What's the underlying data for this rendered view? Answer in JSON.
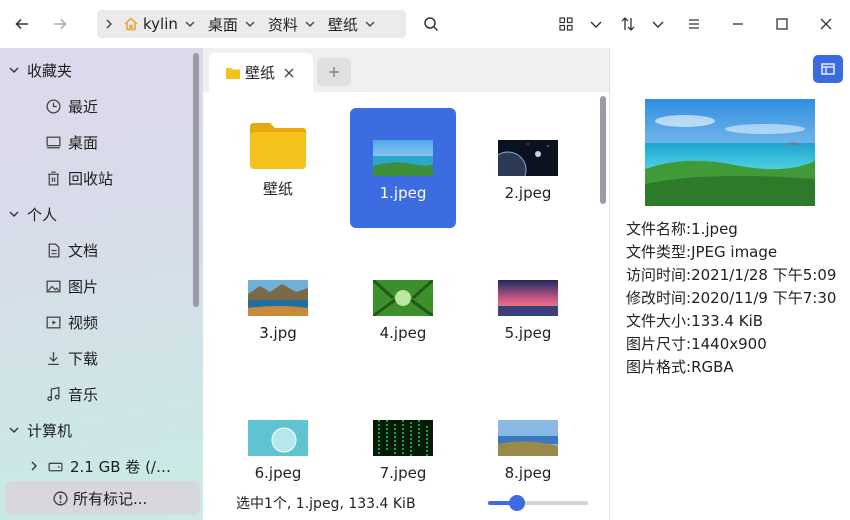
{
  "breadcrumb": [
    {
      "label": "kylin"
    },
    {
      "label": "桌面"
    },
    {
      "label": "资料"
    },
    {
      "label": "壁纸"
    }
  ],
  "sidebar": {
    "sections": [
      {
        "label": "收藏夹"
      },
      {
        "label": "个人"
      },
      {
        "label": "计算机"
      }
    ],
    "items": [
      {
        "label": "最近",
        "icon": "clock-icon"
      },
      {
        "label": "桌面",
        "icon": "desktop-icon"
      },
      {
        "label": "回收站",
        "icon": "trash-icon"
      },
      {
        "label": "文档",
        "icon": "document-icon"
      },
      {
        "label": "图片",
        "icon": "image-icon"
      },
      {
        "label": "视频",
        "icon": "video-icon"
      },
      {
        "label": "下载",
        "icon": "download-icon"
      },
      {
        "label": "音乐",
        "icon": "music-icon"
      },
      {
        "label": "2.1 GB 卷 (/…",
        "icon": "drive-icon"
      },
      {
        "label": "所有标记...",
        "icon": "tag-icon"
      }
    ]
  },
  "tabs": [
    {
      "label": "壁纸"
    }
  ],
  "files": [
    {
      "name": "壁纸",
      "type": "folder"
    },
    {
      "name": "1.jpeg",
      "type": "image",
      "selected": true
    },
    {
      "name": "2.jpeg",
      "type": "image"
    },
    {
      "name": "3.jpg",
      "type": "image"
    },
    {
      "name": "4.jpeg",
      "type": "image"
    },
    {
      "name": "5.jpeg",
      "type": "image"
    },
    {
      "name": "6.jpeg",
      "type": "image"
    },
    {
      "name": "7.jpeg",
      "type": "image"
    },
    {
      "name": "8.jpeg",
      "type": "image"
    }
  ],
  "status": {
    "text": "选中1个, 1.jpeg, 133.4 KiB",
    "zoom_fraction": 0.29
  },
  "details": [
    {
      "key": "文件名称:",
      "value": "1.jpeg"
    },
    {
      "key": "文件类型:",
      "value": "JPEG image"
    },
    {
      "key": "访问时间:",
      "value": "2021/1/28 下午5:09"
    },
    {
      "key": "修改时间:",
      "value": "2020/11/9 下午7:30"
    },
    {
      "key": "文件大小:",
      "value": "133.4 KiB"
    },
    {
      "key": "图片尺寸:",
      "value": "1440x900"
    },
    {
      "key": "图片格式:",
      "value": "RGBA"
    }
  ],
  "colors": {
    "accent": "#3d6be0",
    "folder": "#f5c21b"
  }
}
